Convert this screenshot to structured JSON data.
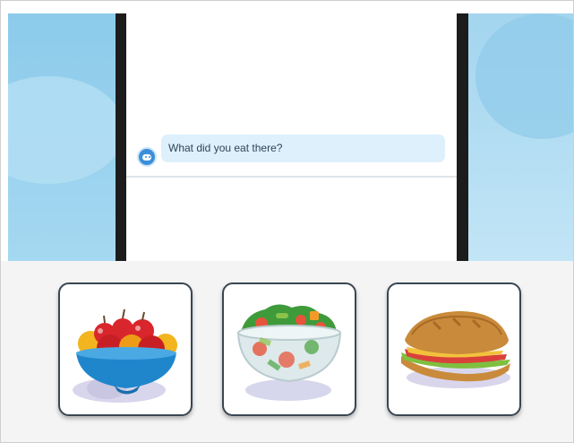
{
  "chat": {
    "message": "What did you eat there?",
    "avatar_icon": "robot-icon"
  },
  "choices": [
    {
      "icon": "fruit-bowl-icon"
    },
    {
      "icon": "salad-bowl-icon"
    },
    {
      "icon": "sandwich-icon"
    }
  ],
  "colors": {
    "sky": "#9dd3ee",
    "pillar": "#1c1c1c",
    "bubble": "#ddf0fc",
    "card_border": "#3a4652",
    "tray": "#f4f4f4"
  }
}
